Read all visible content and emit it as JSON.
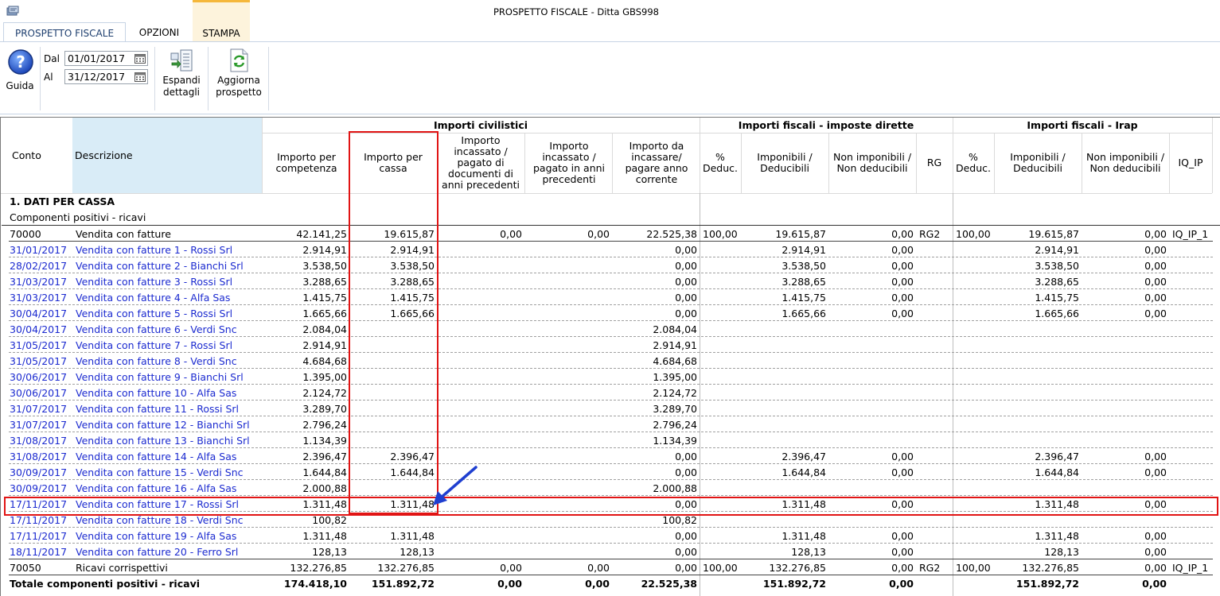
{
  "window": {
    "title": "PROSPETTO FISCALE - Ditta GBS998"
  },
  "tabs": [
    {
      "label": "PROSPETTO FISCALE",
      "active": true
    },
    {
      "label": "OPZIONI",
      "active": false
    },
    {
      "label": "STAMPA",
      "active": false
    }
  ],
  "ribbon": {
    "help_label": "Guida",
    "dal_label": "Dal",
    "dal_value": "01/01/2017",
    "al_label": "Al",
    "al_value": "31/12/2017",
    "espandi_line1": "Espandi",
    "espandi_line2": "dettagli",
    "aggiorna_line1": "Aggiorna",
    "aggiorna_line2": "prospetto"
  },
  "headers": {
    "conto": "Conto",
    "descrizione": "Descrizione",
    "group_civ": "Importi civilistici",
    "group_dir": "Importi fiscali - imposte dirette",
    "group_irap": "Importi fiscali - Irap",
    "comp": "Importo per competenza",
    "cassa": "Importo per cassa",
    "inc_prec_doc": "Importo incassato / pagato di documenti di anni precedenti",
    "inc_prec": "Importo incassato / pagato in anni precedenti",
    "da_inc": "Importo da incassare/ pagare anno corrente",
    "perc1": "% Deduc.",
    "imp1": "Imponibili / Deducibili",
    "nonimp1": "Non imponibili / Non deducibili",
    "rg": "RG",
    "perc2": "% Deduc.",
    "imp2": "Imponibili / Deducibili",
    "nonimp2": "Non imponibili / Non deducibili",
    "iq": "IQ_IP"
  },
  "section_title": "1. DATI PER CASSA",
  "subsection_title": "Componenti positivi - ricavi",
  "rows": [
    {
      "conto": "70000",
      "desc": "Vendita con fatture",
      "comp": "42.141,25",
      "cassa": "19.615,87",
      "inc_prec_doc": "0,00",
      "inc_prec": "0,00",
      "da_inc": "22.525,38",
      "perc1": "100,00",
      "imp1": "19.615,87",
      "nonimp1": "0,00",
      "rg": "RG2",
      "perc2": "100,00",
      "imp2": "19.615,87",
      "nonimp2": "0,00",
      "iq": "IQ_IP_1",
      "type": "main"
    },
    {
      "conto": "31/01/2017",
      "desc": "Vendita con fatture 1 -  Rossi Srl",
      "comp": "2.914,91",
      "cassa": "2.914,91",
      "inc_prec_doc": "",
      "inc_prec": "",
      "da_inc": "0,00",
      "perc1": "",
      "imp1": "2.914,91",
      "nonimp1": "0,00",
      "rg": "",
      "perc2": "",
      "imp2": "2.914,91",
      "nonimp2": "0,00",
      "iq": "",
      "type": "detail"
    },
    {
      "conto": "28/02/2017",
      "desc": "Vendita con fatture 2 -  Bianchi Srl",
      "comp": "3.538,50",
      "cassa": "3.538,50",
      "inc_prec_doc": "",
      "inc_prec": "",
      "da_inc": "0,00",
      "perc1": "",
      "imp1": "3.538,50",
      "nonimp1": "0,00",
      "rg": "",
      "perc2": "",
      "imp2": "3.538,50",
      "nonimp2": "0,00",
      "iq": "",
      "type": "detail"
    },
    {
      "conto": "31/03/2017",
      "desc": "Vendita con fatture 3 -  Rossi Srl",
      "comp": "3.288,65",
      "cassa": "3.288,65",
      "inc_prec_doc": "",
      "inc_prec": "",
      "da_inc": "0,00",
      "perc1": "",
      "imp1": "3.288,65",
      "nonimp1": "0,00",
      "rg": "",
      "perc2": "",
      "imp2": "3.288,65",
      "nonimp2": "0,00",
      "iq": "",
      "type": "detail"
    },
    {
      "conto": "31/03/2017",
      "desc": "Vendita con fatture 4 -  Alfa Sas",
      "comp": "1.415,75",
      "cassa": "1.415,75",
      "inc_prec_doc": "",
      "inc_prec": "",
      "da_inc": "0,00",
      "perc1": "",
      "imp1": "1.415,75",
      "nonimp1": "0,00",
      "rg": "",
      "perc2": "",
      "imp2": "1.415,75",
      "nonimp2": "0,00",
      "iq": "",
      "type": "detail"
    },
    {
      "conto": "30/04/2017",
      "desc": "Vendita con fatture 5 -  Rossi Srl",
      "comp": "1.665,66",
      "cassa": "1.665,66",
      "inc_prec_doc": "",
      "inc_prec": "",
      "da_inc": "0,00",
      "perc1": "",
      "imp1": "1.665,66",
      "nonimp1": "0,00",
      "rg": "",
      "perc2": "",
      "imp2": "1.665,66",
      "nonimp2": "0,00",
      "iq": "",
      "type": "detail"
    },
    {
      "conto": "30/04/2017",
      "desc": "Vendita con fatture 6 -  Verdi Snc",
      "comp": "2.084,04",
      "cassa": "",
      "inc_prec_doc": "",
      "inc_prec": "",
      "da_inc": "2.084,04",
      "perc1": "",
      "imp1": "",
      "nonimp1": "",
      "rg": "",
      "perc2": "",
      "imp2": "",
      "nonimp2": "",
      "iq": "",
      "type": "detail"
    },
    {
      "conto": "31/05/2017",
      "desc": "Vendita con fatture 7 -  Rossi Srl",
      "comp": "2.914,91",
      "cassa": "",
      "inc_prec_doc": "",
      "inc_prec": "",
      "da_inc": "2.914,91",
      "perc1": "",
      "imp1": "",
      "nonimp1": "",
      "rg": "",
      "perc2": "",
      "imp2": "",
      "nonimp2": "",
      "iq": "",
      "type": "detail"
    },
    {
      "conto": "31/05/2017",
      "desc": "Vendita con fatture 8 -  Verdi Snc",
      "comp": "4.684,68",
      "cassa": "",
      "inc_prec_doc": "",
      "inc_prec": "",
      "da_inc": "4.684,68",
      "perc1": "",
      "imp1": "",
      "nonimp1": "",
      "rg": "",
      "perc2": "",
      "imp2": "",
      "nonimp2": "",
      "iq": "",
      "type": "detail"
    },
    {
      "conto": "30/06/2017",
      "desc": "Vendita con fatture 9 -  Bianchi Srl",
      "comp": "1.395,00",
      "cassa": "",
      "inc_prec_doc": "",
      "inc_prec": "",
      "da_inc": "1.395,00",
      "perc1": "",
      "imp1": "",
      "nonimp1": "",
      "rg": "",
      "perc2": "",
      "imp2": "",
      "nonimp2": "",
      "iq": "",
      "type": "detail"
    },
    {
      "conto": "30/06/2017",
      "desc": "Vendita con fatture 10 -  Alfa Sas",
      "comp": "2.124,72",
      "cassa": "",
      "inc_prec_doc": "",
      "inc_prec": "",
      "da_inc": "2.124,72",
      "perc1": "",
      "imp1": "",
      "nonimp1": "",
      "rg": "",
      "perc2": "",
      "imp2": "",
      "nonimp2": "",
      "iq": "",
      "type": "detail"
    },
    {
      "conto": "31/07/2017",
      "desc": "Vendita con fatture 11 -  Rossi Srl",
      "comp": "3.289,70",
      "cassa": "",
      "inc_prec_doc": "",
      "inc_prec": "",
      "da_inc": "3.289,70",
      "perc1": "",
      "imp1": "",
      "nonimp1": "",
      "rg": "",
      "perc2": "",
      "imp2": "",
      "nonimp2": "",
      "iq": "",
      "type": "detail"
    },
    {
      "conto": "31/07/2017",
      "desc": "Vendita con fatture 12 -  Bianchi Srl",
      "comp": "2.796,24",
      "cassa": "",
      "inc_prec_doc": "",
      "inc_prec": "",
      "da_inc": "2.796,24",
      "perc1": "",
      "imp1": "",
      "nonimp1": "",
      "rg": "",
      "perc2": "",
      "imp2": "",
      "nonimp2": "",
      "iq": "",
      "type": "detail"
    },
    {
      "conto": "31/08/2017",
      "desc": "Vendita con fatture 13 -  Bianchi Srl",
      "comp": "1.134,39",
      "cassa": "",
      "inc_prec_doc": "",
      "inc_prec": "",
      "da_inc": "1.134,39",
      "perc1": "",
      "imp1": "",
      "nonimp1": "",
      "rg": "",
      "perc2": "",
      "imp2": "",
      "nonimp2": "",
      "iq": "",
      "type": "detail"
    },
    {
      "conto": "31/08/2017",
      "desc": "Vendita con fatture 14 -  Alfa Sas",
      "comp": "2.396,47",
      "cassa": "2.396,47",
      "inc_prec_doc": "",
      "inc_prec": "",
      "da_inc": "0,00",
      "perc1": "",
      "imp1": "2.396,47",
      "nonimp1": "0,00",
      "rg": "",
      "perc2": "",
      "imp2": "2.396,47",
      "nonimp2": "0,00",
      "iq": "",
      "type": "detail"
    },
    {
      "conto": "30/09/2017",
      "desc": "Vendita con fatture 15 -  Verdi Snc",
      "comp": "1.644,84",
      "cassa": "1.644,84",
      "inc_prec_doc": "",
      "inc_prec": "",
      "da_inc": "0,00",
      "perc1": "",
      "imp1": "1.644,84",
      "nonimp1": "0,00",
      "rg": "",
      "perc2": "",
      "imp2": "1.644,84",
      "nonimp2": "0,00",
      "iq": "",
      "type": "detail"
    },
    {
      "conto": "30/09/2017",
      "desc": "Vendita con fatture 16 -  Alfa Sas",
      "comp": "2.000,88",
      "cassa": "",
      "inc_prec_doc": "",
      "inc_prec": "",
      "da_inc": "2.000,88",
      "perc1": "",
      "imp1": "",
      "nonimp1": "",
      "rg": "",
      "perc2": "",
      "imp2": "",
      "nonimp2": "",
      "iq": "",
      "type": "detail"
    },
    {
      "conto": "17/11/2017",
      "desc": "Vendita con fatture 17 -  Rossi Srl",
      "comp": "1.311,48",
      "cassa": "1.311,48",
      "inc_prec_doc": "",
      "inc_prec": "",
      "da_inc": "0,00",
      "perc1": "",
      "imp1": "1.311,48",
      "nonimp1": "0,00",
      "rg": "",
      "perc2": "",
      "imp2": "1.311,48",
      "nonimp2": "0,00",
      "iq": "",
      "type": "detail"
    },
    {
      "conto": "17/11/2017",
      "desc": "Vendita con fatture 18 -  Verdi Snc",
      "comp": "100,82",
      "cassa": "",
      "inc_prec_doc": "",
      "inc_prec": "",
      "da_inc": "100,82",
      "perc1": "",
      "imp1": "",
      "nonimp1": "",
      "rg": "",
      "perc2": "",
      "imp2": "",
      "nonimp2": "",
      "iq": "",
      "type": "detail"
    },
    {
      "conto": "17/11/2017",
      "desc": "Vendita con fatture 19 -  Alfa Sas",
      "comp": "1.311,48",
      "cassa": "1.311,48",
      "inc_prec_doc": "",
      "inc_prec": "",
      "da_inc": "0,00",
      "perc1": "",
      "imp1": "1.311,48",
      "nonimp1": "0,00",
      "rg": "",
      "perc2": "",
      "imp2": "1.311,48",
      "nonimp2": "0,00",
      "iq": "",
      "type": "detail"
    },
    {
      "conto": "18/11/2017",
      "desc": "Vendita con fatture 20 -  Ferro Srl",
      "comp": "128,13",
      "cassa": "128,13",
      "inc_prec_doc": "",
      "inc_prec": "",
      "da_inc": "0,00",
      "perc1": "",
      "imp1": "128,13",
      "nonimp1": "0,00",
      "rg": "",
      "perc2": "",
      "imp2": "128,13",
      "nonimp2": "0,00",
      "iq": "",
      "type": "detail"
    },
    {
      "conto": "70050",
      "desc": "Ricavi corrispettivi",
      "comp": "132.276,85",
      "cassa": "132.276,85",
      "inc_prec_doc": "0,00",
      "inc_prec": "0,00",
      "da_inc": "0,00",
      "perc1": "100,00",
      "imp1": "132.276,85",
      "nonimp1": "0,00",
      "rg": "RG2",
      "perc2": "100,00",
      "imp2": "132.276,85",
      "nonimp2": "0,00",
      "iq": "IQ_IP_1",
      "type": "main"
    }
  ],
  "total": {
    "label": "Totale componenti positivi - ricavi",
    "comp": "174.418,10",
    "cassa": "151.892,72",
    "inc_prec_doc": "0,00",
    "inc_prec": "0,00",
    "da_inc": "22.525,38",
    "imp1": "151.892,72",
    "nonimp1": "0,00",
    "imp2": "151.892,72",
    "nonimp2": "0,00"
  },
  "colors": {
    "accent_red": "#e11414",
    "arrow_blue": "#1f3fd0",
    "link_blue": "#1c2bd0",
    "desc_header_bg": "#d9ecf7"
  }
}
